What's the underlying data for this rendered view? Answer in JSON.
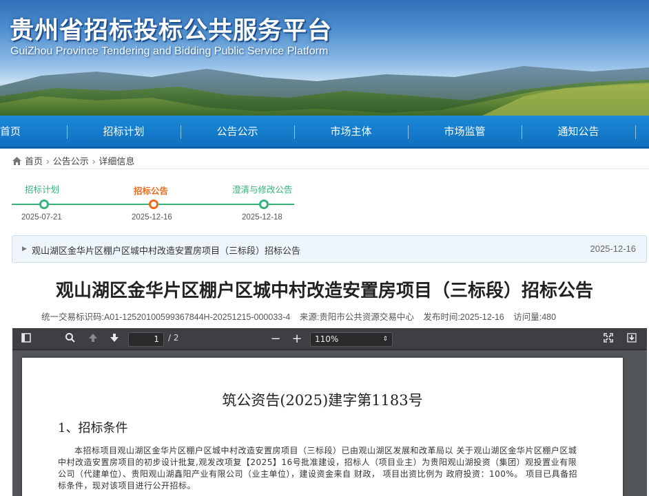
{
  "banner": {
    "title": "贵州省招标投标公共服务平台",
    "subtitle": "GuiZhou Province Tendering and Bidding Public Service Platform"
  },
  "nav": {
    "items": [
      "首页",
      "招标计划",
      "公告公示",
      "市场主体",
      "市场监管",
      "通知公告"
    ]
  },
  "breadcrumb": {
    "home": "首页",
    "section": "公告公示",
    "current": "详细信息"
  },
  "timeline": {
    "steps": [
      {
        "label": "招标计划",
        "date": "2025-07-21",
        "active": false
      },
      {
        "label": "招标公告",
        "date": "2025-12-16",
        "active": true
      },
      {
        "label": "澄清与修改公告",
        "date": "2025-12-18",
        "active": false
      }
    ]
  },
  "notice": {
    "title": "观山湖区金华片区棚户区城中村改造安置房项目（三标段）招标公告",
    "date": "2025-12-16"
  },
  "article": {
    "title": "观山湖区金华片区棚户区城中村改造安置房项目（三标段）招标公告",
    "meta_id": "统一交易标识码:A01-12520100599367844H-20251215-000033-4",
    "meta_source": "来源:贵阳市公共资源交易中心",
    "meta_time": "发布时间:2025-12-16",
    "meta_views": "访问量:480"
  },
  "pdf_viewer": {
    "page_current": "1",
    "page_total": "/ 2",
    "zoom": "110%",
    "doc_number": "筑公资告(2025)建字第1183号",
    "section_heading": "1、招标条件",
    "paragraph": "本招标项目观山湖区金华片区棚户区城中村改造安置房项目（三标段）已由观山湖区发展和改革局以 关于观山湖区金华片区棚户区城中村改造安置房项目的初步设计批复,观发改项复【2025】16号批准建设，招标人（项目业主）为贵阳观山湖投资（集团）观投置业有限公司（代建单位）、贵阳观山湖鑫阳产业有限公司（业主单位），建设资金来自 财政， 项目出资比例为 政府投资：100%。 项目已具备招标条件，现对该项目进行公开招标。"
  },
  "colors": {
    "nav_blue": "#1b8ad8",
    "timeline_green": "#35b37a",
    "timeline_active": "#ee6b1d"
  }
}
